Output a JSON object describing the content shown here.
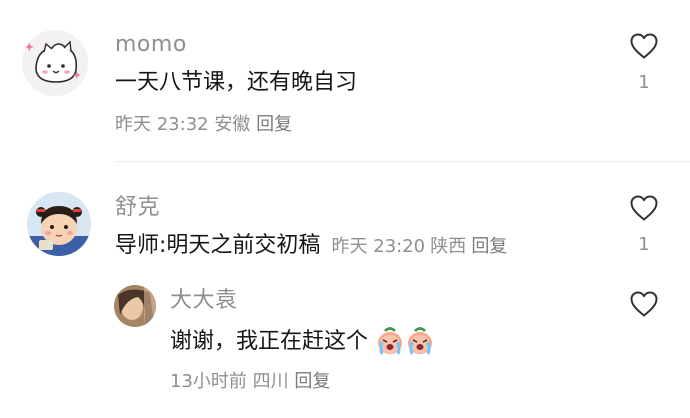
{
  "comments": [
    {
      "username": "momo",
      "content": "一天八节课，还有晚自习",
      "time": "昨天 23:32",
      "location": "安徽",
      "reply_label": "回复",
      "like_count": "1"
    },
    {
      "username": "舒克",
      "content": "导师:明天之前交初稿",
      "time": "昨天 23:20",
      "location": "陕西",
      "reply_label": "回复",
      "like_count": "1"
    }
  ],
  "replies": [
    {
      "username": "大大袁",
      "content": "谢谢，我正在赶这个",
      "emoji_icons": [
        "crying-peach-emoji",
        "crying-peach-emoji"
      ],
      "time": "13小时前",
      "location": "四川",
      "reply_label": "回复",
      "like_count": ""
    }
  ],
  "icons": {
    "like": "heart-outline-icon"
  },
  "colors": {
    "primary_text": "#161616",
    "secondary_text": "#8f8f8f",
    "divider": "#ededed"
  }
}
